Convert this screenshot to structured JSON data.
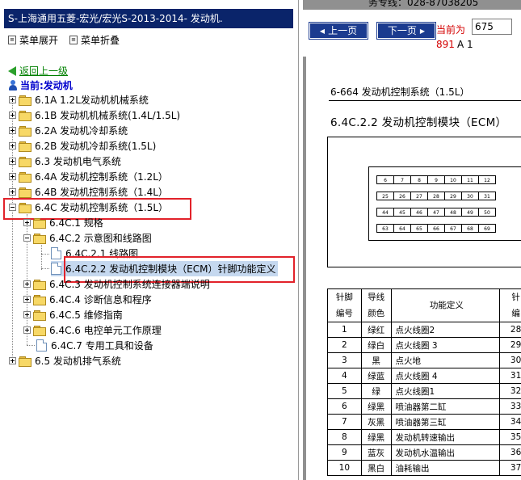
{
  "left": {
    "title": "S-上海通用五菱-宏光/宏光S-2013-2014- 发动机.",
    "menu": {
      "expand": "菜单展开",
      "collapse": "菜单折叠"
    },
    "back_label": "返回上一级",
    "current_label": "当前:发动机",
    "tree": [
      {
        "label": "6.1A 1.2L发动机机械系统",
        "expanded": false
      },
      {
        "label": "6.1B 发动机机械系统(1.4L/1.5L)",
        "expanded": false
      },
      {
        "label": "6.2A 发动机冷却系统",
        "expanded": false
      },
      {
        "label": "6.2B 发动机冷却系统(1.5L)",
        "expanded": false
      },
      {
        "label": "6.3 发动机电气系统",
        "expanded": false
      },
      {
        "label": "6.4A 发动机控制系统（1.2L）",
        "expanded": false
      },
      {
        "label": "6.4B 发动机控制系统（1.4L）",
        "expanded": false
      },
      {
        "label": "6.4C 发动机控制系统（1.5L）",
        "expanded": true
      },
      {
        "label": "6.4C.1 规格",
        "expanded": false
      },
      {
        "label": "6.4C.2 示意图和线路图",
        "expanded": true
      },
      {
        "label": "6.4C.2.1 线路图",
        "leaf": true
      },
      {
        "label": "6.4C.2.2 发动机控制模块（ECM）针脚功能定义",
        "leaf": true,
        "selected": true
      },
      {
        "label": "6.4C.3 发动机控制系统连接器端说明",
        "expanded": false
      },
      {
        "label": "6.4C.4 诊断信息和程序",
        "expanded": false
      },
      {
        "label": "6.4C.5 维修指南",
        "expanded": false
      },
      {
        "label": "6.4C.6 电控单元工作原理",
        "expanded": false
      },
      {
        "label": "6.4C.7 专用工具和设备",
        "leaf": true
      },
      {
        "label": "6.5 发动机排气系统",
        "expanded": false
      }
    ]
  },
  "right": {
    "hotline": "务专线：028-87038205",
    "prev_label": "上一页",
    "next_label": "下一页",
    "current_page_label": "当前为",
    "page_value": "675",
    "page_count": "891",
    "page_suffix": "A 1",
    "doc_header": "6-664  发动机控制系统（1.5L）",
    "doc_subtitle": "6.4C.2.2    发动机控制模块（ECM）",
    "connector_rows": [
      [
        "6",
        "7",
        "8",
        "9",
        "10",
        "11",
        "12"
      ],
      [
        "25",
        "26",
        "27",
        "28",
        "29",
        "30",
        "31"
      ],
      [
        "44",
        "45",
        "46",
        "47",
        "48",
        "49",
        "50"
      ],
      [
        "63",
        "64",
        "65",
        "66",
        "67",
        "68",
        "69"
      ]
    ],
    "table": {
      "headers": [
        "针脚\n编号",
        "导线\n颜色",
        "功能定义",
        "针\n编"
      ],
      "rows": [
        [
          "1",
          "绿红",
          "点火线圈2",
          "28"
        ],
        [
          "2",
          "绿白",
          "点火线圈 3",
          "29"
        ],
        [
          "3",
          "黑",
          "点火地",
          "30"
        ],
        [
          "4",
          "绿蓝",
          "点火线圈 4",
          "31"
        ],
        [
          "5",
          "绿",
          "点火线圈1",
          "32"
        ],
        [
          "6",
          "绿黑",
          "喷油器第二缸",
          "33"
        ],
        [
          "7",
          "灰黑",
          "喷油器第三缸",
          "34"
        ],
        [
          "8",
          "绿黑",
          "发动机转速输出",
          "35"
        ],
        [
          "9",
          "蓝灰",
          "发动机水温输出",
          "36"
        ],
        [
          "10",
          "黑白",
          "油耗输出",
          "37"
        ]
      ]
    }
  }
}
